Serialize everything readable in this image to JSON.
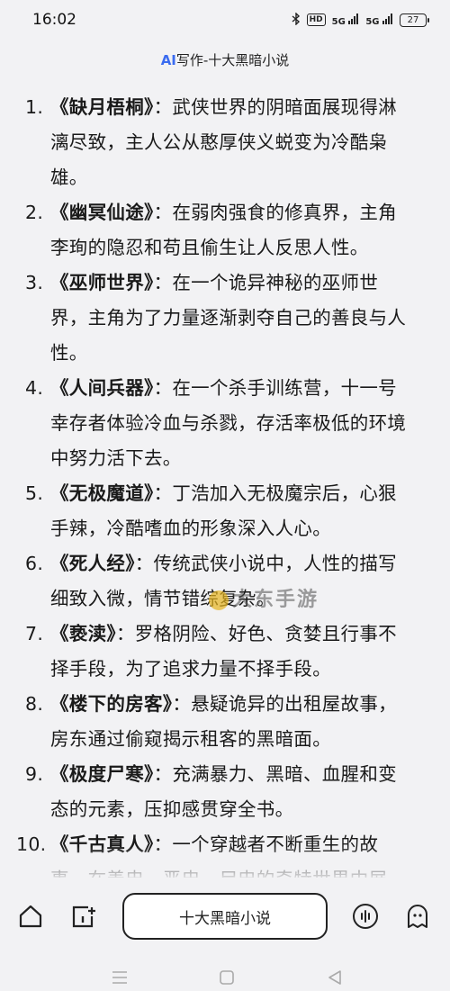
{
  "status": {
    "time": "16:02",
    "signal_1": "5G",
    "signal_2": "5G",
    "hd": "HD",
    "battery": "27"
  },
  "header": {
    "ai_label": "AI",
    "title": "写作-十大黑暗小说"
  },
  "items": [
    {
      "num": "1.",
      "book": "《缺月梧桐》",
      "desc": "：武侠世界的阴暗面展现得淋漓尽致，主人公从憨厚侠义蜕变为冷酷枭雄。"
    },
    {
      "num": "2.",
      "book": "《幽冥仙途》",
      "desc": "：在弱肉强食的修真界，主角李珣的隐忍和苟且偷生让人反思人性。"
    },
    {
      "num": "3.",
      "book": "《巫师世界》",
      "desc": "：在一个诡异神秘的巫师世界，主角为了力量逐渐剥夺自己的善良与人性。"
    },
    {
      "num": "4.",
      "book": "《人间兵器》",
      "desc": "：在一个杀手训练营，十一号幸存者体验冷血与杀戮，存活率极低的环境中努力活下去。"
    },
    {
      "num": "5.",
      "book": "《无极魔道》",
      "desc": "：丁浩加入无极魔宗后，心狠手辣，冷酷嗜血的形象深入人心。"
    },
    {
      "num": "6.",
      "book": "《死人经》",
      "desc": "：传统武侠小说中，人性的描写细致入微，情节错综复杂。"
    },
    {
      "num": "7.",
      "book": "《亵渎》",
      "desc": "：罗格阴险、好色、贪婪且行事不择手段，为了追求力量不择手段。"
    },
    {
      "num": "8.",
      "book": "《楼下的房客》",
      "desc": "：悬疑诡异的出租屋故事，房东通过偷窥揭示租客的黑暗面。"
    },
    {
      "num": "9.",
      "book": "《极度尸寒》",
      "desc": "：充满暴力、黑暗、血腥和变态的元素，压抑感贯穿全书。"
    },
    {
      "num": "10.",
      "book": "《千古真人》",
      "desc": "：一个穿越者不断重生的故事，在善忠、恶忠、尸忠的奇特世界中展"
    }
  ],
  "watermark": "大东手游",
  "bottom": {
    "center_button": "十大黑暗小说"
  },
  "icons": {
    "home": "home-icon",
    "new_chat": "new-chat-icon",
    "voice": "voice-icon",
    "assistant": "assistant-icon"
  },
  "colors": {
    "accent": "#3b6cf0",
    "background": "#f2f2f4"
  }
}
